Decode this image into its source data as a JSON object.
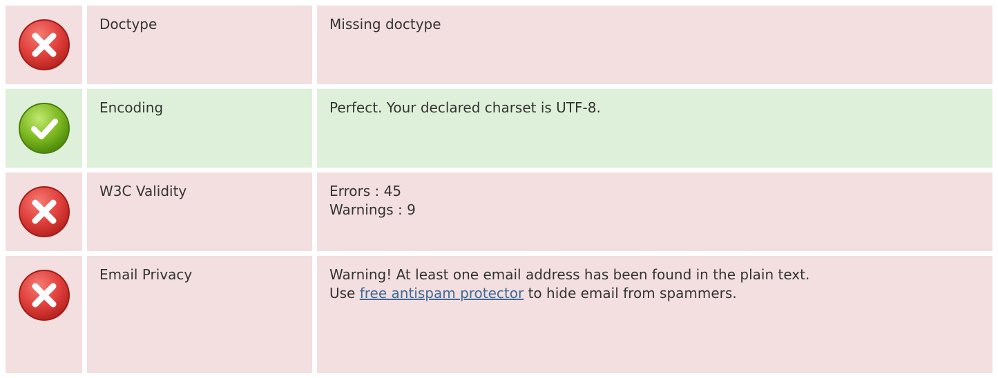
{
  "colors": {
    "error_row_bg": "#f3dfe0",
    "ok_row_bg": "#dff0da",
    "error_icon": "#e0403c",
    "ok_icon": "#7cb81f",
    "link": "#3d6a96"
  },
  "rows": [
    {
      "status": "error",
      "icon": "error-cross-icon",
      "label": "Doctype",
      "value": "Missing doctype"
    },
    {
      "status": "ok",
      "icon": "ok-check-icon",
      "label": "Encoding",
      "value": "Perfect. Your declared charset is UTF-8."
    },
    {
      "status": "error",
      "icon": "error-cross-icon",
      "label": "W3C Validity",
      "lines": [
        "Errors : 45",
        "Warnings : 9"
      ]
    },
    {
      "status": "error",
      "icon": "error-cross-icon",
      "label": "Email Privacy",
      "line1": "Warning! At least one email address has been found in the plain text.",
      "line2_prefix": "Use ",
      "link_text": "free antispam protector",
      "line2_suffix": " to hide email from spammers."
    }
  ]
}
